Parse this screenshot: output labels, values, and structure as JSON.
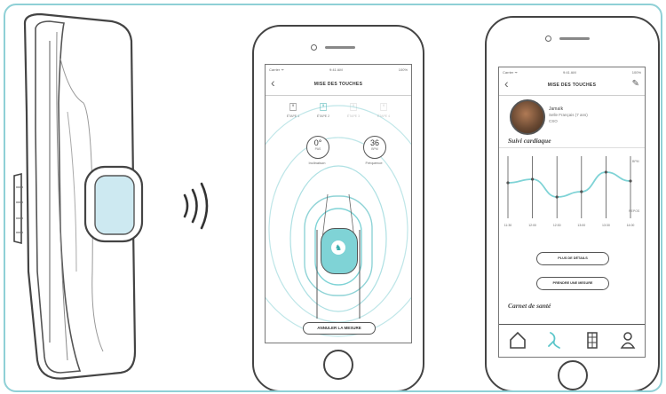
{
  "phone1": {
    "status": {
      "carrier": "Carrier ᯤ",
      "time": "9:41 AM",
      "battery": "100%"
    },
    "nav_title": "MISE DES TOUCHES",
    "steps": [
      "ÉTAPE 1",
      "ÉTAPE 2",
      "ÉTAPE 3",
      "ÉTAPE 4"
    ],
    "gauge_left": {
      "value": "0°",
      "unit": "PAS",
      "label": "Inclinaison"
    },
    "gauge_right": {
      "value": "36",
      "unit": "BPM",
      "label": "Fréquence"
    },
    "cancel_label": "ANNULER LA MESURE"
  },
  "phone2": {
    "status": {
      "carrier": "Carrier ᯤ",
      "time": "9:41 AM",
      "battery": "100%"
    },
    "nav_title": "MISE DES TOUCHES",
    "profile": {
      "name": "Jamaïk",
      "line2": "Selle Français (7 ans)",
      "line3": "CSO"
    },
    "section1": "Suivi cardiaque",
    "chart_labels": {
      "top": "BPM",
      "bottom": "REPOS"
    },
    "x_ticks": [
      "11:30",
      "12:00",
      "12:30",
      "13:00",
      "13:30",
      "14:00"
    ],
    "more_details": "PLUS DE DÉTAILS",
    "take_measure": "PRENDRE UNE MESURE",
    "section2": "Carnet de santé"
  },
  "chart_data": {
    "type": "line",
    "x": [
      "11:30",
      "12:00",
      "12:30",
      "13:00",
      "13:30",
      "14:00"
    ],
    "series": [
      {
        "values": [
          38,
          40,
          30,
          33,
          44,
          39
        ]
      }
    ],
    "ylabel": "BPM",
    "color": "#7fd3d6"
  },
  "colors": {
    "accent": "#7fd3d6",
    "frame": "#8fd0d6",
    "line": "#444444"
  },
  "icons": [
    "wifi-signal-icon",
    "edit-pencil-icon",
    "home-icon",
    "walk-icon",
    "stable-icon",
    "profile-icon",
    "horse-icon"
  ]
}
